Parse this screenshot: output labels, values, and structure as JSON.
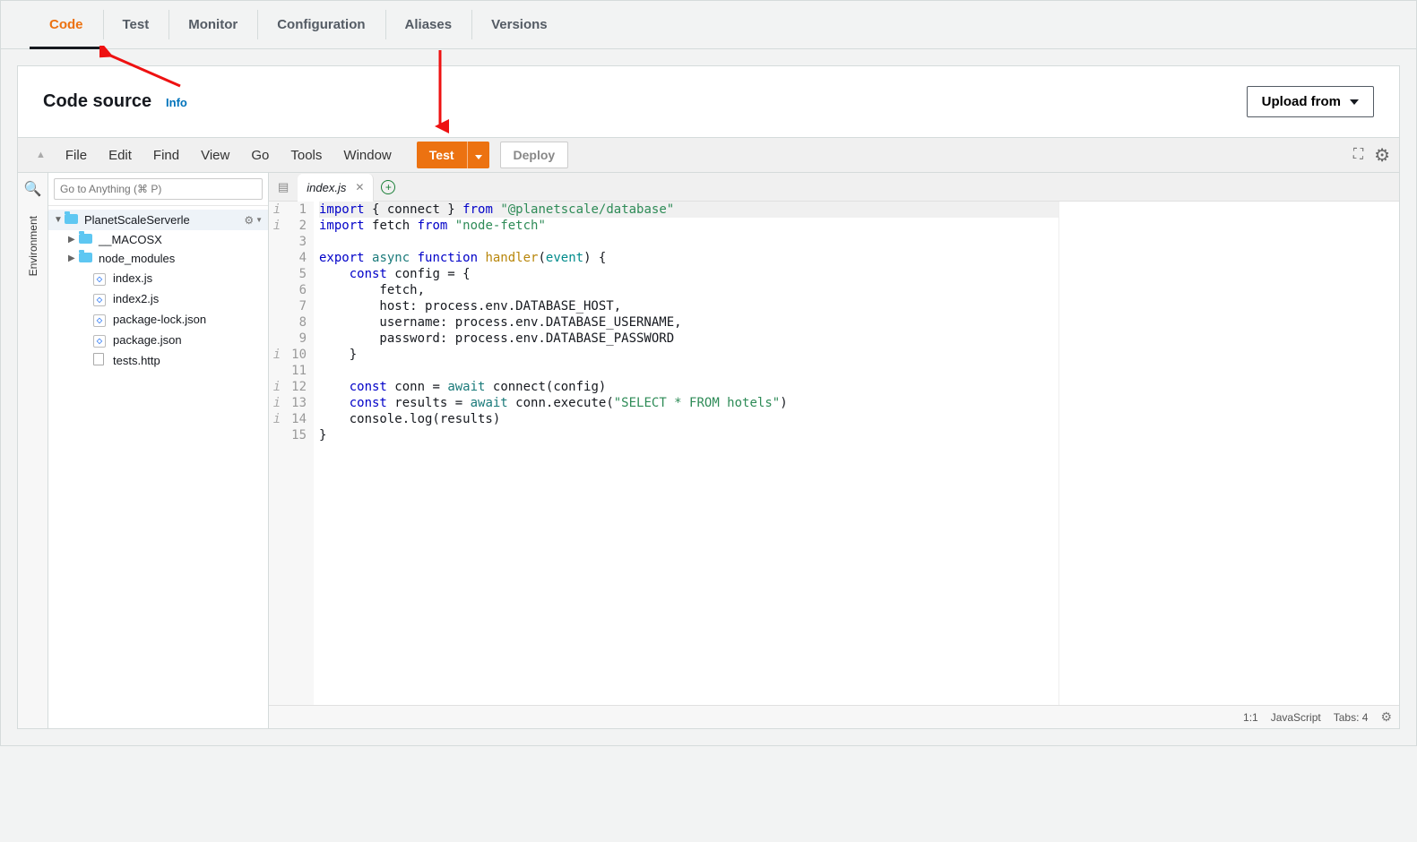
{
  "tabs": {
    "items": [
      "Code",
      "Test",
      "Monitor",
      "Configuration",
      "Aliases",
      "Versions"
    ],
    "active": "Code"
  },
  "panel": {
    "title": "Code source",
    "info": "Info",
    "upload_label": "Upload from"
  },
  "ide_menu": [
    "File",
    "Edit",
    "Find",
    "View",
    "Go",
    "Tools",
    "Window"
  ],
  "buttons": {
    "test": "Test",
    "deploy": "Deploy"
  },
  "sidebar": {
    "goto_placeholder": "Go to Anything (⌘ P)",
    "env_label": "Environment"
  },
  "tree": {
    "root": "PlanetScaleServerle",
    "children": [
      {
        "type": "folder",
        "name": "__MACOSX"
      },
      {
        "type": "folder",
        "name": "node_modules"
      },
      {
        "type": "js",
        "name": "index.js"
      },
      {
        "type": "js",
        "name": "index2.js"
      },
      {
        "type": "js",
        "name": "package-lock.json"
      },
      {
        "type": "js",
        "name": "package.json"
      },
      {
        "type": "doc",
        "name": "tests.http"
      }
    ]
  },
  "editor_tab": {
    "name": "index.js"
  },
  "code": {
    "markers": [
      "i",
      "i",
      "",
      "",
      "",
      "",
      "",
      "",
      "",
      "i",
      "",
      "i",
      "i",
      "i",
      ""
    ],
    "line_numbers": [
      "1",
      "2",
      "3",
      "4",
      "5",
      "6",
      "7",
      "8",
      "9",
      "10",
      "11",
      "12",
      "13",
      "14",
      "15"
    ],
    "lines": [
      [
        {
          "t": "import ",
          "c": "kw-blue"
        },
        {
          "t": "{ connect } ",
          "c": "norm"
        },
        {
          "t": "from ",
          "c": "kw-blue"
        },
        {
          "t": "\"@planetscale/database\"",
          "c": "str"
        }
      ],
      [
        {
          "t": "import ",
          "c": "kw-blue"
        },
        {
          "t": "fetch ",
          "c": "norm"
        },
        {
          "t": "from ",
          "c": "kw-blue"
        },
        {
          "t": "\"node-fetch\"",
          "c": "str"
        }
      ],
      [
        {
          "t": "",
          "c": "norm"
        }
      ],
      [
        {
          "t": "export ",
          "c": "kw-blue"
        },
        {
          "t": "async ",
          "c": "kw-teal"
        },
        {
          "t": "function ",
          "c": "kw-blue"
        },
        {
          "t": "handler",
          "c": "func"
        },
        {
          "t": "(",
          "c": "norm"
        },
        {
          "t": "event",
          "c": "id"
        },
        {
          "t": ") {",
          "c": "norm"
        }
      ],
      [
        {
          "t": "    ",
          "c": "norm"
        },
        {
          "t": "const ",
          "c": "kw-blue"
        },
        {
          "t": "config = {",
          "c": "norm"
        }
      ],
      [
        {
          "t": "        fetch,",
          "c": "norm"
        }
      ],
      [
        {
          "t": "        host: process.env.DATABASE_HOST,",
          "c": "norm"
        }
      ],
      [
        {
          "t": "        username: process.env.DATABASE_USERNAME,",
          "c": "norm"
        }
      ],
      [
        {
          "t": "        password: process.env.DATABASE_PASSWORD",
          "c": "norm"
        }
      ],
      [
        {
          "t": "    }",
          "c": "norm"
        }
      ],
      [
        {
          "t": "",
          "c": "norm"
        }
      ],
      [
        {
          "t": "    ",
          "c": "norm"
        },
        {
          "t": "const ",
          "c": "kw-blue"
        },
        {
          "t": "conn = ",
          "c": "norm"
        },
        {
          "t": "await ",
          "c": "kw-teal"
        },
        {
          "t": "connect(config)",
          "c": "norm"
        }
      ],
      [
        {
          "t": "    ",
          "c": "norm"
        },
        {
          "t": "const ",
          "c": "kw-blue"
        },
        {
          "t": "results = ",
          "c": "norm"
        },
        {
          "t": "await ",
          "c": "kw-teal"
        },
        {
          "t": "conn.execute(",
          "c": "norm"
        },
        {
          "t": "\"SELECT * FROM hotels\"",
          "c": "str"
        },
        {
          "t": ")",
          "c": "norm"
        }
      ],
      [
        {
          "t": "    console.log(results)",
          "c": "norm"
        }
      ],
      [
        {
          "t": "}",
          "c": "norm"
        }
      ]
    ]
  },
  "status": {
    "pos": "1:1",
    "lang": "JavaScript",
    "tabs": "Tabs: 4"
  }
}
